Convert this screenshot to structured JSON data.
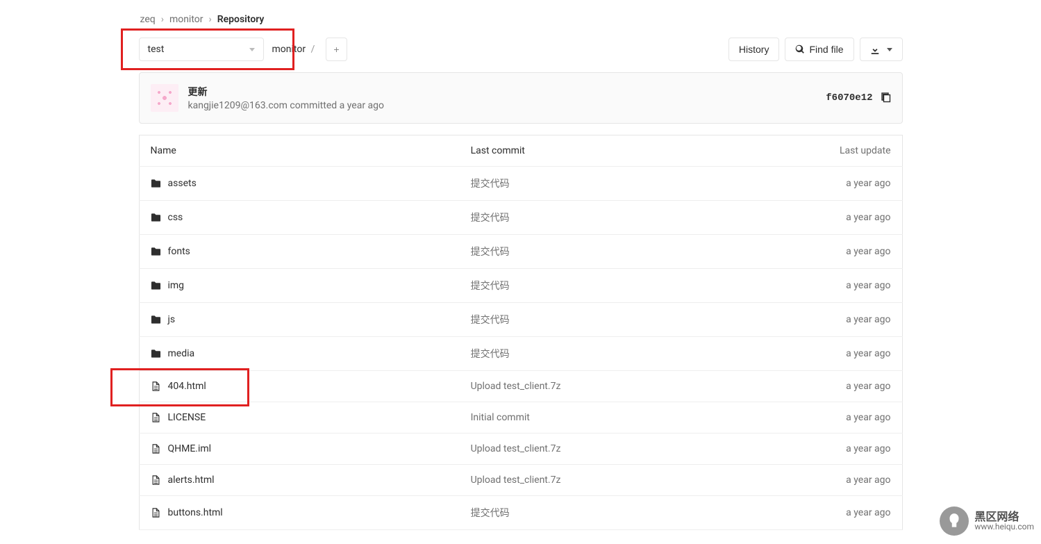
{
  "breadcrumb": {
    "seg1": "zeq",
    "seg2": "monitor",
    "seg3": "Repository"
  },
  "branch": {
    "selected": "test"
  },
  "path": {
    "seg1": "monitor"
  },
  "toolbar": {
    "plus_label": "+",
    "history_label": "History",
    "find_file_label": "Find file"
  },
  "commit": {
    "title": "更新",
    "author": "kangjie1209@163.com",
    "committed_text": "committed",
    "time_ago": "a year ago",
    "sha": "f6070e12"
  },
  "table": {
    "headers": {
      "name": "Name",
      "last_commit": "Last commit",
      "last_update": "Last update"
    },
    "rows": [
      {
        "type": "folder",
        "name": "assets",
        "commit": "提交代码",
        "update": "a year ago"
      },
      {
        "type": "folder",
        "name": "css",
        "commit": "提交代码",
        "update": "a year ago"
      },
      {
        "type": "folder",
        "name": "fonts",
        "commit": "提交代码",
        "update": "a year ago"
      },
      {
        "type": "folder",
        "name": "img",
        "commit": "提交代码",
        "update": "a year ago"
      },
      {
        "type": "folder",
        "name": "js",
        "commit": "提交代码",
        "update": "a year ago"
      },
      {
        "type": "folder",
        "name": "media",
        "commit": "提交代码",
        "update": "a year ago"
      },
      {
        "type": "file",
        "name": "404.html",
        "commit": "Upload test_client.7z",
        "update": "a year ago",
        "highlight": true
      },
      {
        "type": "file",
        "name": "LICENSE",
        "commit": "Initial commit",
        "update": "a year ago"
      },
      {
        "type": "file",
        "name": "QHME.iml",
        "commit": "Upload test_client.7z",
        "update": "a year ago"
      },
      {
        "type": "file",
        "name": "alerts.html",
        "commit": "Upload test_client.7z",
        "update": "a year ago"
      },
      {
        "type": "file",
        "name": "buttons.html",
        "commit": "提交代码",
        "update": "a year ago"
      }
    ]
  },
  "watermark": {
    "cn": "黑区网络",
    "url": "www.heiqu.com"
  }
}
